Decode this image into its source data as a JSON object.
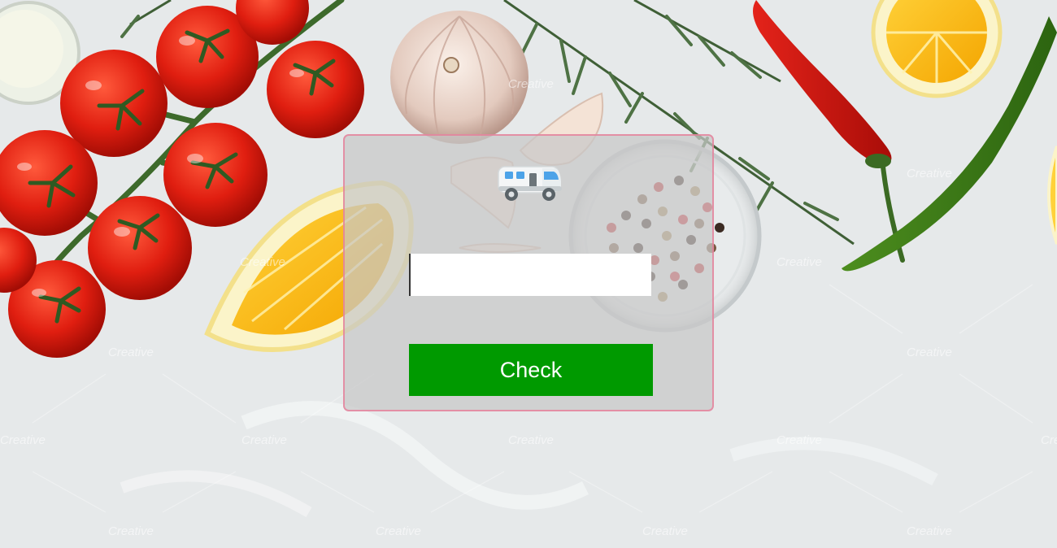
{
  "background": {
    "scene": "kitchen-ingredients-photo",
    "watermark_text": "Creative"
  },
  "panel": {
    "icon": "camper-van-icon",
    "input": {
      "value": "",
      "placeholder": ""
    },
    "check_button_label": "Check"
  },
  "colors": {
    "button": "#009a00",
    "panel_border": "#e8789b"
  }
}
